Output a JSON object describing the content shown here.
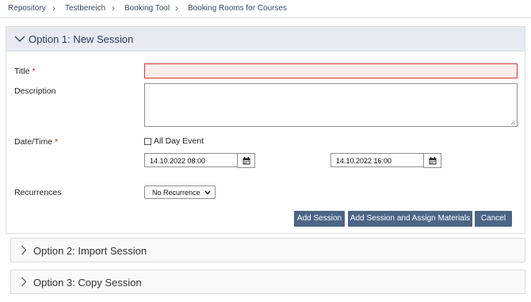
{
  "breadcrumb": [
    "Repository",
    "Testbereich",
    "Booking Tool",
    "Booking Rooms for Courses"
  ],
  "option1": {
    "title": "Option 1: New Session",
    "fields": {
      "title_label": "Title",
      "description_label": "Description",
      "datetime_label": "Date/Time",
      "recurrences_label": "Recurrences",
      "required_mark": "*",
      "title_value": "",
      "description_value": "",
      "all_day_label": "All Day Event",
      "all_day_checked": false,
      "start_datetime": "14.10.2022 08:00",
      "end_datetime": "14.10.2022 16:00",
      "recurrence_selected": "No Recurrence"
    },
    "buttons": {
      "add_session": "Add Session",
      "add_assign": "Add Session and Assign Materials",
      "cancel": "Cancel"
    }
  },
  "option2": {
    "title": "Option 2: Import Session"
  },
  "option3": {
    "title": "Option 3: Copy Session"
  },
  "colors": {
    "button_bg": "#4c6586",
    "panel_header_bg": "#e7ebf1",
    "required_red": "#c81e1e",
    "title_error_bg": "#fdecec",
    "title_error_border": "#d13b3b"
  }
}
